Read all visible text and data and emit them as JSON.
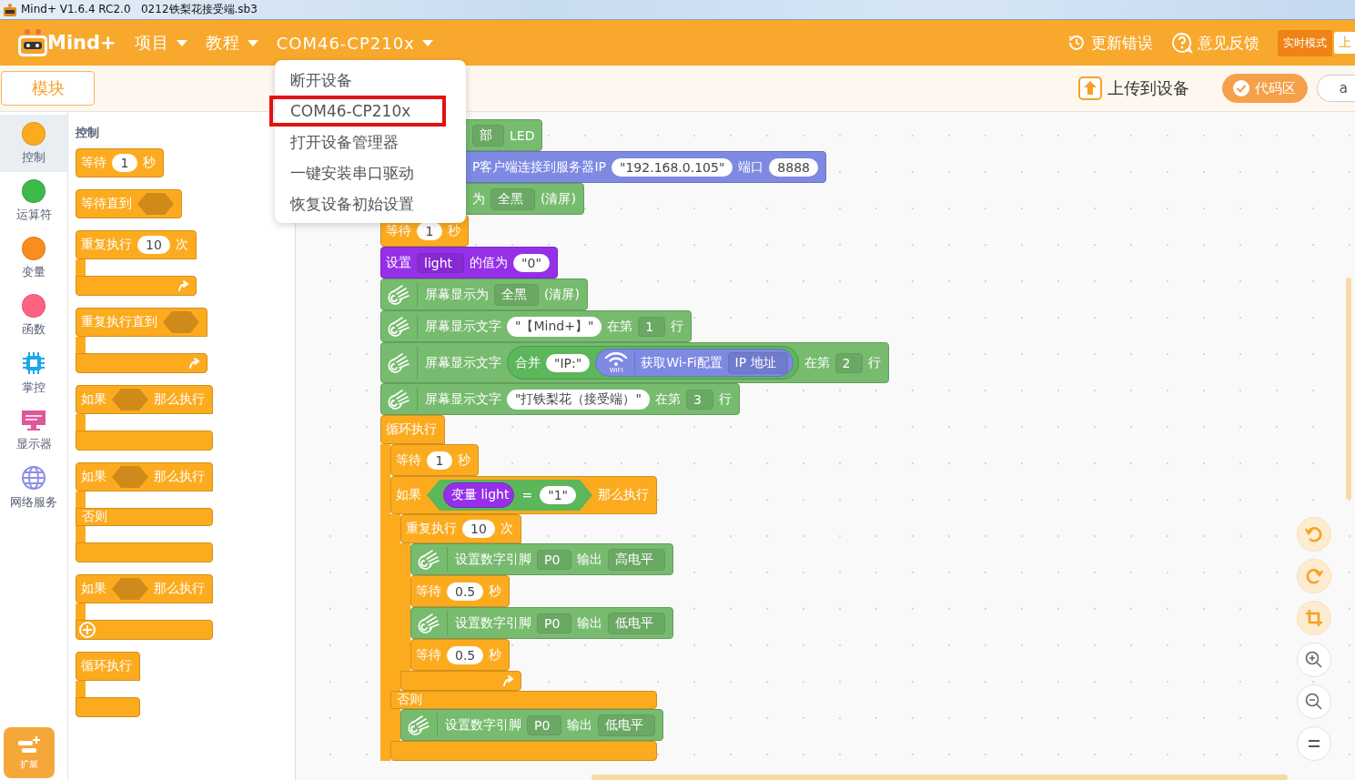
{
  "title_bar": {
    "title": "Mind+ V1.6.4 RC2.0   0212铁梨花接受端.sb3"
  },
  "menu_bar": {
    "logo": "Mind+",
    "items": [
      {
        "label": "项目"
      },
      {
        "label": "教程"
      },
      {
        "label": "COM46-CP210x"
      }
    ],
    "right_items": [
      {
        "kind": "history",
        "label": "更新错误"
      },
      {
        "kind": "help",
        "label": "意见反馈"
      }
    ],
    "mode_button": "实时模式",
    "cut_button": "上"
  },
  "device_menu": {
    "items": [
      {
        "label": "断开设备",
        "outlined": false
      },
      {
        "label": "COM46-CP210x",
        "outlined": true
      },
      {
        "label": "打开设备管理器",
        "outlined": false
      },
      {
        "label": "一键安装串口驱动",
        "outlined": false
      },
      {
        "label": "恢复设备初始设置",
        "outlined": false
      }
    ]
  },
  "toolbar": {
    "tabs": [
      {
        "label": "模块",
        "selected": true
      }
    ],
    "upload": "上传到设备",
    "code_toggle": {
      "label": "代码区",
      "on": true
    },
    "cut_button": "a"
  },
  "categories": [
    {
      "label": "控制",
      "kind": "dot",
      "color": "#fcab1f",
      "selected": true
    },
    {
      "label": "运算符",
      "kind": "dot",
      "color": "#3dba4a",
      "selected": false
    },
    {
      "label": "变量",
      "kind": "dot",
      "color": "#fb8c1e",
      "selected": false
    },
    {
      "label": "函数",
      "kind": "dot",
      "color": "#fd6381",
      "selected": false
    },
    {
      "label": "掌控",
      "kind": "chip",
      "selected": false
    },
    {
      "label": "显示器",
      "kind": "monitor",
      "selected": false
    },
    {
      "label": "网络服务",
      "kind": "globe",
      "selected": false
    }
  ],
  "extension_button": "扩展",
  "palette": {
    "title": "控制",
    "blocks": [
      {
        "kind": "stack",
        "color": "#fcab1f",
        "parts": [
          {
            "kind": "text",
            "text": "等待"
          },
          {
            "kind": "num",
            "text": "1"
          },
          {
            "kind": "text",
            "text": "秒"
          }
        ]
      },
      {
        "kind": "stack",
        "color": "#fcab1f",
        "parts": [
          {
            "kind": "text",
            "text": "等待直到"
          },
          {
            "kind": "slot"
          }
        ]
      },
      {
        "kind": "c",
        "color": "#fcab1f",
        "arrow": true,
        "plus": false,
        "closed": true,
        "parts": [
          {
            "kind": "text",
            "text": "重复执行"
          },
          {
            "kind": "num",
            "text": "10"
          },
          {
            "kind": "text",
            "text": "次"
          }
        ]
      },
      {
        "kind": "c",
        "color": "#fcab1f",
        "arrow": true,
        "plus": false,
        "closed": true,
        "parts": [
          {
            "kind": "text",
            "text": "重复执行直到"
          },
          {
            "kind": "slot"
          }
        ]
      },
      {
        "kind": "c",
        "color": "#fcab1f",
        "arrow": false,
        "plus": false,
        "closed": true,
        "parts": [
          {
            "kind": "text",
            "text": "如果"
          },
          {
            "kind": "slot"
          },
          {
            "kind": "text",
            "text": "那么执行"
          }
        ]
      },
      {
        "kind": "c",
        "color": "#fcab1f",
        "arrow": false,
        "plus": false,
        "closed": true,
        "parts": [
          {
            "kind": "text",
            "text": "如果"
          },
          {
            "kind": "slot"
          },
          {
            "kind": "text",
            "text": "那么执行"
          }
        ],
        "else_label": "否则"
      },
      {
        "kind": "c",
        "color": "#fcab1f",
        "arrow": false,
        "plus": true,
        "closed": true,
        "parts": [
          {
            "kind": "text",
            "text": "如果"
          },
          {
            "kind": "slot"
          },
          {
            "kind": "text",
            "text": "那么执行"
          }
        ]
      },
      {
        "kind": "c",
        "color": "#fcab1f",
        "arrow": false,
        "plus": false,
        "closed": true,
        "parts": [
          {
            "kind": "text",
            "text": "循环执行"
          }
        ]
      }
    ]
  },
  "script": {
    "blocks": [
      {
        "kind": "stack",
        "color": "#77bb6f",
        "covered": true,
        "parts": [
          {
            "kind": "dropdown",
            "text": "部"
          },
          {
            "kind": "text",
            "text": "LED"
          }
        ]
      },
      {
        "kind": "stack",
        "color": "#7e89e2",
        "covered": true,
        "parts": [
          {
            "kind": "text",
            "text": "P客户端连接到服务器IP"
          },
          {
            "kind": "string",
            "text": "\"192.168.0.105\""
          },
          {
            "kind": "text",
            "text": "端口"
          },
          {
            "kind": "num",
            "text": "8888"
          }
        ]
      },
      {
        "kind": "stack",
        "color": "#77bb6f",
        "covered": true,
        "parts": [
          {
            "kind": "text",
            "text": "为"
          },
          {
            "kind": "dropdown",
            "text": "全黑"
          },
          {
            "kind": "text",
            "text": "(清屏)"
          }
        ]
      },
      {
        "kind": "stack",
        "color": "#fcab1f",
        "covered": false,
        "parts": [
          {
            "kind": "text",
            "text": "等待"
          },
          {
            "kind": "num",
            "text": "1"
          },
          {
            "kind": "text",
            "text": "秒"
          }
        ]
      },
      {
        "kind": "stack",
        "color": "#9530e8",
        "covered": false,
        "parts": [
          {
            "kind": "text",
            "text": "设置"
          },
          {
            "kind": "dropdown",
            "text": "light"
          },
          {
            "kind": "text",
            "text": "的值为"
          },
          {
            "kind": "string",
            "text": "\"0\""
          }
        ]
      },
      {
        "kind": "stack",
        "color": "#77bb6f",
        "covered": false,
        "parts": [
          {
            "kind": "ext-icon"
          },
          {
            "kind": "text",
            "text": "屏幕显示为"
          },
          {
            "kind": "dropdown",
            "text": "全黑"
          },
          {
            "kind": "text",
            "text": "(清屏)"
          }
        ]
      },
      {
        "kind": "stack",
        "color": "#77bb6f",
        "covered": false,
        "parts": [
          {
            "kind": "ext-icon"
          },
          {
            "kind": "text",
            "text": "屏幕显示文字"
          },
          {
            "kind": "string",
            "text": "\"【Mind+】\""
          },
          {
            "kind": "text",
            "text": "在第"
          },
          {
            "kind": "dropdown",
            "text": "1"
          },
          {
            "kind": "text",
            "text": "行"
          }
        ]
      },
      {
        "kind": "stack",
        "color": "#77bb6f",
        "covered": false,
        "parts": [
          {
            "kind": "ext-icon"
          },
          {
            "kind": "text",
            "text": "屏幕显示文字"
          },
          {
            "kind": "reporter",
            "color": "#5cb65a",
            "parts": [
              {
                "kind": "text",
                "text": "合并"
              },
              {
                "kind": "string",
                "text": "\"IP:\""
              },
              {
                "kind": "reporter",
                "color": "#7e89e2",
                "parts": [
                  {
                    "kind": "wifi",
                    "label": "WIFI"
                  },
                  {
                    "kind": "text",
                    "text": "获取Wi-Fi配置"
                  },
                  {
                    "kind": "dropdown",
                    "text": "IP 地址"
                  }
                ]
              }
            ]
          },
          {
            "kind": "text",
            "text": "在第"
          },
          {
            "kind": "dropdown",
            "text": "2"
          },
          {
            "kind": "text",
            "text": "行"
          }
        ]
      },
      {
        "kind": "stack",
        "color": "#77bb6f",
        "covered": false,
        "parts": [
          {
            "kind": "ext-icon"
          },
          {
            "kind": "text",
            "text": "屏幕显示文字"
          },
          {
            "kind": "string",
            "text": "\"打铁梨花（接受端）\""
          },
          {
            "kind": "text",
            "text": "在第"
          },
          {
            "kind": "dropdown",
            "text": "3"
          },
          {
            "kind": "text",
            "text": "行"
          }
        ]
      },
      {
        "kind": "c",
        "color": "#fcab1f",
        "closed": false,
        "parts": [
          {
            "kind": "text",
            "text": "循环执行"
          }
        ],
        "body": [
          {
            "kind": "stack",
            "color": "#fcab1f",
            "covered": false,
            "parts": [
              {
                "kind": "text",
                "text": "等待"
              },
              {
                "kind": "num",
                "text": "1"
              },
              {
                "kind": "text",
                "text": "秒"
              }
            ]
          },
          {
            "kind": "c",
            "color": "#fcab1f",
            "arrow": false,
            "plus": false,
            "closed": true,
            "parts": [
              {
                "kind": "text",
                "text": "如果"
              },
              {
                "kind": "bool",
                "color": "#5cb65a",
                "parts": [
                  {
                    "kind": "reporter",
                    "color": "#9530e8",
                    "parts": [
                      {
                        "kind": "text",
                        "text": "变量 light"
                      }
                    ]
                  },
                  {
                    "kind": "text",
                    "text": "="
                  },
                  {
                    "kind": "string",
                    "text": "\"1\""
                  }
                ]
              },
              {
                "kind": "text",
                "text": "那么执行"
              }
            ],
            "body": [
              {
                "kind": "c",
                "color": "#fcab1f",
                "arrow": true,
                "plus": false,
                "closed": true,
                "parts": [
                  {
                    "kind": "text",
                    "text": "重复执行"
                  },
                  {
                    "kind": "num",
                    "text": "10"
                  },
                  {
                    "kind": "text",
                    "text": "次"
                  }
                ],
                "body": [
                  {
                    "kind": "stack",
                    "color": "#77bb6f",
                    "covered": false,
                    "parts": [
                      {
                        "kind": "ext-icon"
                      },
                      {
                        "kind": "text",
                        "text": "设置数字引脚"
                      },
                      {
                        "kind": "dropdown",
                        "text": "P0"
                      },
                      {
                        "kind": "text",
                        "text": "输出"
                      },
                      {
                        "kind": "dropdown",
                        "text": "高电平"
                      }
                    ]
                  },
                  {
                    "kind": "stack",
                    "color": "#fcab1f",
                    "covered": false,
                    "parts": [
                      {
                        "kind": "text",
                        "text": "等待"
                      },
                      {
                        "kind": "num",
                        "text": "0.5"
                      },
                      {
                        "kind": "text",
                        "text": "秒"
                      }
                    ]
                  },
                  {
                    "kind": "stack",
                    "color": "#77bb6f",
                    "covered": false,
                    "parts": [
                      {
                        "kind": "ext-icon"
                      },
                      {
                        "kind": "text",
                        "text": "设置数字引脚"
                      },
                      {
                        "kind": "dropdown",
                        "text": "P0"
                      },
                      {
                        "kind": "text",
                        "text": "输出"
                      },
                      {
                        "kind": "dropdown",
                        "text": "低电平"
                      }
                    ]
                  },
                  {
                    "kind": "stack",
                    "color": "#fcab1f",
                    "covered": false,
                    "parts": [
                      {
                        "kind": "text",
                        "text": "等待"
                      },
                      {
                        "kind": "num",
                        "text": "0.5"
                      },
                      {
                        "kind": "text",
                        "text": "秒"
                      }
                    ]
                  }
                ]
              }
            ],
            "else_label": "否则",
            "else_body": [
              {
                "kind": "stack",
                "color": "#77bb6f",
                "covered": false,
                "parts": [
                  {
                    "kind": "ext-icon"
                  },
                  {
                    "kind": "text",
                    "text": "设置数字引脚"
                  },
                  {
                    "kind": "dropdown",
                    "text": "P0"
                  },
                  {
                    "kind": "text",
                    "text": "输出"
                  },
                  {
                    "kind": "dropdown",
                    "text": "低电平"
                  }
                ]
              }
            ]
          }
        ]
      }
    ]
  }
}
